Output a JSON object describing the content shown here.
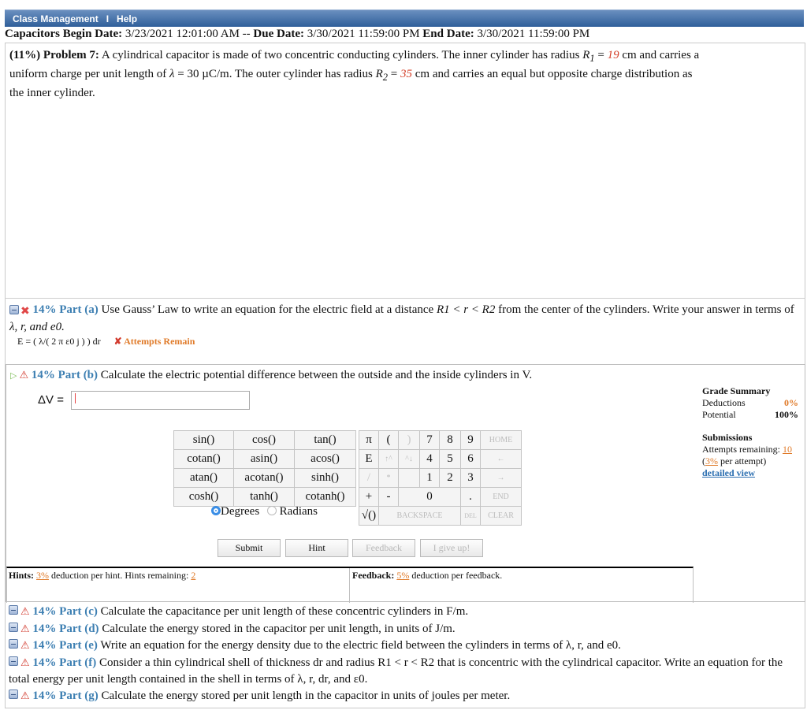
{
  "topbar": {
    "menu1": "Class Management",
    "sep": "I",
    "menu2": "Help"
  },
  "assignment": {
    "name": "Capacitors",
    "begin_label": "Begin Date:",
    "begin": "3/23/2021 12:01:00 AM",
    "dash": "--",
    "due_label": "Due Date:",
    "due": "3/30/2021 11:59:00 PM",
    "end_label": "End Date:",
    "end": "3/30/2021 11:59:00 PM"
  },
  "problem": {
    "weight": "(11%)",
    "label": "Problem 7:",
    "text1": "A cylindrical capacitor is made of two concentric conducting cylinders. The inner cylinder has radius",
    "r1": "R",
    "r1sub": "1",
    "eq": "=",
    "r1val": "19",
    "unit_cm": "cm",
    "text2": "and carries a uniform charge per unit length of",
    "lambda": "λ",
    "lambda_val": "= 30 µC/m. The outer cylinder has radius",
    "r2": "R",
    "r2sub": "2",
    "r2val": "35",
    "text3": "cm and carries an equal but opposite charge distribution as the inner cylinder."
  },
  "part_a": {
    "pct": "14% Part (a)",
    "text": "Use Gauss’ Law to write an equation for the electric field at a distance",
    "cond": "R1 < r < R2",
    "text2": "from the center of the cylinders. Write your answer in terms of",
    "vars": "λ, r, and e0.",
    "answer": "E = ( λ/( 2 π ε0 j ) ) dr",
    "status": "Attempts Remain"
  },
  "part_b": {
    "pct": "14% Part (b)",
    "text": "Calculate the electric potential difference between the outside and the inside cylinders in V.",
    "input_label": "ΔV =",
    "input_value": "|"
  },
  "grade": {
    "title": "Grade Summary",
    "deductions_label": "Deductions",
    "deductions": "0%",
    "potential_label": "Potential",
    "potential": "100%",
    "submissions_title": "Submissions",
    "attempts_label": "Attempts remaining:",
    "attempts": "10",
    "per_attempt_pct": "3%",
    "per_attempt_text": "per attempt)",
    "paren": "(",
    "detail": "detailed view"
  },
  "functions": [
    [
      "sin()",
      "cos()",
      "tan()"
    ],
    [
      "cotan()",
      "asin()",
      "acos()"
    ],
    [
      "atan()",
      "acotan()",
      "sinh()"
    ],
    [
      "cosh()",
      "tanh()",
      "cotanh()"
    ]
  ],
  "angle": {
    "degrees": "Degrees",
    "radians": "Radians"
  },
  "keypad": {
    "row1": [
      "π",
      "(",
      ")",
      "7",
      "8",
      "9",
      "HOME"
    ],
    "row2": [
      "E",
      "↑^",
      "^↓",
      "4",
      "5",
      "6",
      "←"
    ],
    "row3": [
      "/",
      "*",
      "1",
      "2",
      "3",
      "→"
    ],
    "row4": [
      "+",
      "-",
      "0",
      ".",
      "END"
    ],
    "row5": [
      "√()",
      "BACKSPACE",
      "DEL",
      "CLEAR"
    ]
  },
  "buttons": {
    "submit": "Submit",
    "hint": "Hint",
    "feedback": "Feedback",
    "giveup": "I give up!"
  },
  "hints": {
    "label": "Hints:",
    "pct": "3%",
    "text": "deduction per hint. Hints remaining:",
    "remaining": "2"
  },
  "feedback": {
    "label": "Feedback:",
    "pct": "5%",
    "text": "deduction per feedback."
  },
  "parts_rest": [
    {
      "pct": "14% Part (c)",
      "text": "Calculate the capacitance per unit length of these concentric cylinders in F/m."
    },
    {
      "pct": "14% Part (d)",
      "text": "Calculate the energy stored in the capacitor per unit length, in units of J/m."
    },
    {
      "pct": "14% Part (e)",
      "text": "Write an equation for the energy density due to the electric field between the cylinders in terms of λ, r, and e0."
    },
    {
      "pct": "14% Part (f)",
      "text": "Consider a thin cylindrical shell of thickness dr and radius R1 < r < R2 that is concentric with the cylindrical capacitor. Write an equation for the total energy per unit length contained in the shell in terms of λ, r, dr, and ε0."
    },
    {
      "pct": "14% Part (g)",
      "text": "Calculate the energy stored per unit length in the capacitor in units of joules per meter."
    }
  ]
}
